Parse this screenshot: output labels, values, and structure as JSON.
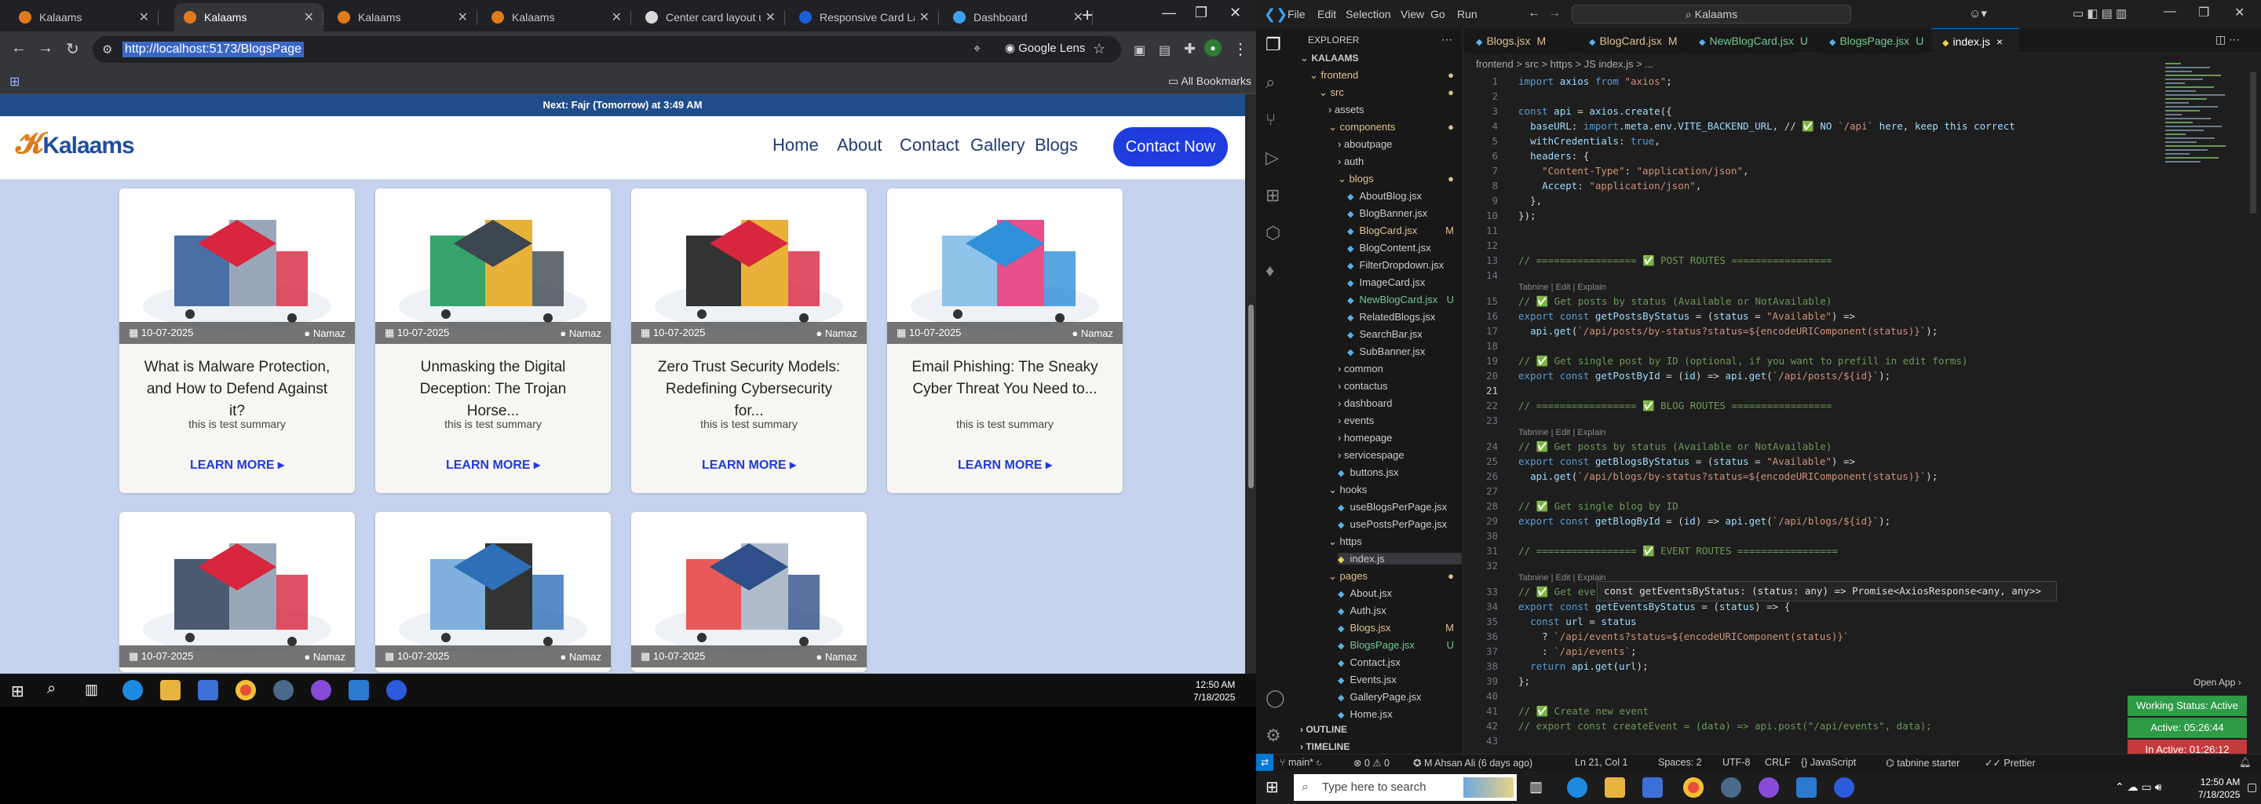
{
  "browser": {
    "tabs": [
      {
        "title": "Kalaams",
        "active": false
      },
      {
        "title": "Kalaams",
        "active": true
      },
      {
        "title": "Kalaams",
        "active": false
      },
      {
        "title": "Kalaams",
        "active": false
      },
      {
        "title": "Center card layout up",
        "active": false
      },
      {
        "title": "Responsive Card Layo",
        "active": false
      },
      {
        "title": "Dashboard",
        "active": false
      }
    ],
    "url": "http://localhost:5173/BlogsPage",
    "lens_label": "Google Lens",
    "all_bookmarks": "All Bookmarks"
  },
  "site": {
    "prayer_banner": "Next: Fajr (Tomorrow) at 3:49 AM",
    "logo_text": "Kalaams",
    "nav": [
      "Home",
      "About",
      "Contact",
      "Gallery",
      "Blogs"
    ],
    "contact_button": "Contact Now",
    "cards": [
      {
        "date": "10-07-2025",
        "category": "Namaz",
        "title": "What is Malware Protection, and How to Defend Against it?",
        "summary": "this is test summary",
        "cta": "LEARN MORE ▸"
      },
      {
        "date": "10-07-2025",
        "category": "Namaz",
        "title": "Unmasking the Digital Deception: The Trojan Horse...",
        "summary": "this is test summary",
        "cta": "LEARN MORE ▸"
      },
      {
        "date": "10-07-2025",
        "category": "Namaz",
        "title": "Zero Trust Security Models: Redefining Cybersecurity for...",
        "summary": "this is test summary",
        "cta": "LEARN MORE ▸"
      },
      {
        "date": "10-07-2025",
        "category": "Namaz",
        "title": "Email Phishing: The Sneaky Cyber Threat You Need to...",
        "summary": "this is test summary",
        "cta": "LEARN MORE ▸"
      },
      {
        "date": "10-07-2025",
        "category": "Namaz",
        "title": "",
        "summary": "",
        "cta": ""
      },
      {
        "date": "10-07-2025",
        "category": "Namaz",
        "title": "",
        "summary": "",
        "cta": ""
      },
      {
        "date": "10-07-2025",
        "category": "Namaz",
        "title": "",
        "summary": "",
        "cta": ""
      }
    ]
  },
  "taskbar_left": {
    "time": "12:50 AM",
    "date": "7/18/2025"
  },
  "vscode": {
    "menu": [
      "File",
      "Edit",
      "Selection",
      "View",
      "Go",
      "Run"
    ],
    "command_center": "Kalaams",
    "explorer_title": "EXPLORER",
    "tree": [
      {
        "label": "KALAAMS",
        "depth": 0,
        "color": "#cccccc",
        "marker": "",
        "folder": true
      },
      {
        "label": "frontend",
        "depth": 1,
        "color": "#e2c08d",
        "marker": "●",
        "folder": true
      },
      {
        "label": "src",
        "depth": 2,
        "color": "#e2c08d",
        "marker": "●",
        "folder": true
      },
      {
        "label": "assets",
        "depth": 3,
        "color": "#cccccc",
        "marker": "",
        "folder": true
      },
      {
        "label": "components",
        "depth": 3,
        "color": "#e2c08d",
        "marker": "●",
        "folder": true
      },
      {
        "label": "aboutpage",
        "depth": 4,
        "color": "#cccccc",
        "marker": "",
        "folder": true
      },
      {
        "label": "auth",
        "depth": 4,
        "color": "#cccccc",
        "marker": "",
        "folder": true
      },
      {
        "label": "blogs",
        "depth": 4,
        "color": "#e2c08d",
        "marker": "●",
        "folder": true
      },
      {
        "label": "AboutBlog.jsx",
        "depth": 5,
        "color": "#cccccc",
        "marker": "",
        "folder": false
      },
      {
        "label": "BlogBanner.jsx",
        "depth": 5,
        "color": "#cccccc",
        "marker": "",
        "folder": false
      },
      {
        "label": "BlogCard.jsx",
        "depth": 5,
        "color": "#e2c08d",
        "marker": "M",
        "folder": false
      },
      {
        "label": "BlogContent.jsx",
        "depth": 5,
        "color": "#cccccc",
        "marker": "",
        "folder": false
      },
      {
        "label": "FilterDropdown.jsx",
        "depth": 5,
        "color": "#cccccc",
        "marker": "",
        "folder": false
      },
      {
        "label": "ImageCard.jsx",
        "depth": 5,
        "color": "#cccccc",
        "marker": "",
        "folder": false
      },
      {
        "label": "NewBlogCard.jsx",
        "depth": 5,
        "color": "#73c991",
        "marker": "U",
        "folder": false
      },
      {
        "label": "RelatedBlogs.jsx",
        "depth": 5,
        "color": "#cccccc",
        "marker": "",
        "folder": false
      },
      {
        "label": "SearchBar.jsx",
        "depth": 5,
        "color": "#cccccc",
        "marker": "",
        "folder": false
      },
      {
        "label": "SubBanner.jsx",
        "depth": 5,
        "color": "#cccccc",
        "marker": "",
        "folder": false
      },
      {
        "label": "common",
        "depth": 4,
        "color": "#cccccc",
        "marker": "",
        "folder": true
      },
      {
        "label": "contactus",
        "depth": 4,
        "color": "#cccccc",
        "marker": "",
        "folder": true
      },
      {
        "label": "dashboard",
        "depth": 4,
        "color": "#cccccc",
        "marker": "",
        "folder": true
      },
      {
        "label": "events",
        "depth": 4,
        "color": "#cccccc",
        "marker": "",
        "folder": true
      },
      {
        "label": "homepage",
        "depth": 4,
        "color": "#cccccc",
        "marker": "",
        "folder": true
      },
      {
        "label": "servicespage",
        "depth": 4,
        "color": "#cccccc",
        "marker": "",
        "folder": true
      },
      {
        "label": "buttons.jsx",
        "depth": 4,
        "color": "#cccccc",
        "marker": "",
        "folder": false
      },
      {
        "label": "hooks",
        "depth": 3,
        "color": "#cccccc",
        "marker": "",
        "folder": true
      },
      {
        "label": "useBlogsPerPage.jsx",
        "depth": 4,
        "color": "#cccccc",
        "marker": "",
        "folder": false
      },
      {
        "label": "usePostsPerPage.jsx",
        "depth": 4,
        "color": "#cccccc",
        "marker": "",
        "folder": false
      },
      {
        "label": "https",
        "depth": 3,
        "color": "#cccccc",
        "marker": "",
        "folder": true
      },
      {
        "label": "index.js",
        "depth": 4,
        "color": "#cccccc",
        "marker": "",
        "folder": false
      },
      {
        "label": "pages",
        "depth": 3,
        "color": "#e2c08d",
        "marker": "●",
        "folder": true
      },
      {
        "label": "About.jsx",
        "depth": 4,
        "color": "#cccccc",
        "marker": "",
        "folder": false
      },
      {
        "label": "Auth.jsx",
        "depth": 4,
        "color": "#cccccc",
        "marker": "",
        "folder": false
      },
      {
        "label": "Blogs.jsx",
        "depth": 4,
        "color": "#e2c08d",
        "marker": "M",
        "folder": false
      },
      {
        "label": "BlogsPage.jsx",
        "depth": 4,
        "color": "#73c991",
        "marker": "U",
        "folder": false
      },
      {
        "label": "Contact.jsx",
        "depth": 4,
        "color": "#cccccc",
        "marker": "",
        "folder": false
      },
      {
        "label": "Events.jsx",
        "depth": 4,
        "color": "#cccccc",
        "marker": "",
        "folder": false
      },
      {
        "label": "GalleryPage.jsx",
        "depth": 4,
        "color": "#cccccc",
        "marker": "",
        "folder": false
      },
      {
        "label": "Home.jsx",
        "depth": 4,
        "color": "#cccccc",
        "marker": "",
        "folder": false
      }
    ],
    "outline": "OUTLINE",
    "timeline": "TIMELINE",
    "editor_tabs": [
      {
        "label": "Blogs.jsx",
        "marker": "M",
        "color": "#e2c08d",
        "active": false
      },
      {
        "label": "BlogCard.jsx",
        "marker": "M",
        "color": "#e2c08d",
        "active": false
      },
      {
        "label": "NewBlogCard.jsx",
        "marker": "U",
        "color": "#73c991",
        "active": false
      },
      {
        "label": "BlogsPage.jsx",
        "marker": "U",
        "color": "#73c991",
        "active": false
      },
      {
        "label": "index.js",
        "marker": "×",
        "color": "#ffffff",
        "active": true
      }
    ],
    "breadcrumb": "frontend > src > https > JS index.js > ...",
    "code_lines": [
      "import axios from \"axios\";",
      "",
      "const api = axios.create({",
      "  baseURL: import.meta.env.VITE_BACKEND_URL, // ✅ NO `/api` here, keep this correct",
      "  withCredentials: true,",
      "  headers: {",
      "    \"Content-Type\": \"application/json\",",
      "    Accept: \"application/json\",",
      "  },",
      "});",
      "",
      "",
      "// ================= ✅ POST ROUTES =================",
      "",
      "// ✅ Get posts by status (Available or NotAvailable)",
      "export const getPostsByStatus = (status = \"Available\") =>",
      "  api.get(`/api/posts/by-status?status=${encodeURIComponent(status)}`);",
      "",
      "// ✅ Get single post by ID (optional, if you want to prefill in edit forms)",
      "export const getPostById = (id) => api.get(`/api/posts/${id}`);",
      "",
      "// ================= ✅ BLOG ROUTES =================",
      "",
      "// ✅ Get posts by status (Available or NotAvailable)",
      "export const getBlogsByStatus = (status = \"Available\") =>",
      "  api.get(`/api/blogs/by-status?status=${encodeURIComponent(status)}`);",
      "",
      "// ✅ Get single blog by ID",
      "export const getBlogById = (id) => api.get(`/api/blogs/${id}`);",
      "",
      "// ================= ✅ EVENT ROUTES =================",
      "",
      "// ✅ Get eve",
      "export const getEventsByStatus = (status) => {",
      "  const url = status",
      "    ? `/api/events?status=${encodeURIComponent(status)}`",
      "    : `/api/events`;",
      "  return api.get(url);",
      "};",
      "",
      "// ✅ Create new event",
      "// export const createEvent = (data) => api.post(\"/api/events\", data);",
      ""
    ],
    "code_hints": [
      {
        "after_line": 15,
        "text": "Tabnine | Edit | Explain"
      },
      {
        "after_line": 24,
        "text": "Tabnine | Edit | Explain"
      },
      {
        "after_line": 33,
        "text": "Tabnine | Edit | Explain"
      }
    ],
    "tooltip": "const getEventsByStatus: (status: any) => Promise<AxiosResponse<any, any>>",
    "status_left": "main*",
    "status_author": "M Ahsan Ali (6 days ago)",
    "status_pos": "Ln 21, Col 1",
    "status_spaces": "Spaces: 2",
    "status_enc": "UTF-8",
    "status_eol": "CRLF",
    "status_lang": "JavaScript",
    "status_tabnine": "tabnine starter",
    "status_prettier": "Prettier",
    "open_app": "Open App ›",
    "working": [
      {
        "label": "Working Status: Active",
        "color": "#2e9b46"
      },
      {
        "label": "Active: 05:26:44",
        "color": "#2e9b46"
      },
      {
        "label": "In Active: 01:26:12",
        "color": "#c43b3b"
      }
    ]
  },
  "taskbar_right": {
    "search_placeholder": "Type here to search",
    "time": "12:50 AM",
    "date": "7/18/2025"
  }
}
